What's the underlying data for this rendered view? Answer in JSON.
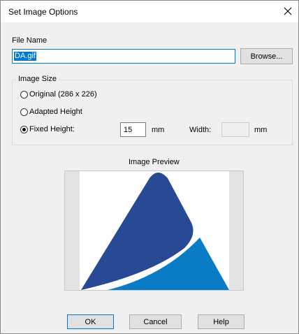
{
  "window": {
    "title": "Set Image Options"
  },
  "file": {
    "label": "File Name",
    "value": "DA.gif",
    "browse_label": "Browse..."
  },
  "image_size": {
    "group_label": "Image Size",
    "options": [
      {
        "label": "Original (286 x 226)",
        "selected": false
      },
      {
        "label": "Adapted Height",
        "selected": false
      },
      {
        "label": "Fixed Height:",
        "selected": true
      }
    ],
    "height_value": "15",
    "height_unit": "mm",
    "width_label": "Width:",
    "width_value": "",
    "width_unit": "mm"
  },
  "preview": {
    "label": "Image Preview",
    "logo_colors": {
      "dark": "#284a95",
      "light": "#0a7cc6"
    }
  },
  "buttons": {
    "ok": "OK",
    "cancel": "Cancel",
    "help": "Help"
  }
}
